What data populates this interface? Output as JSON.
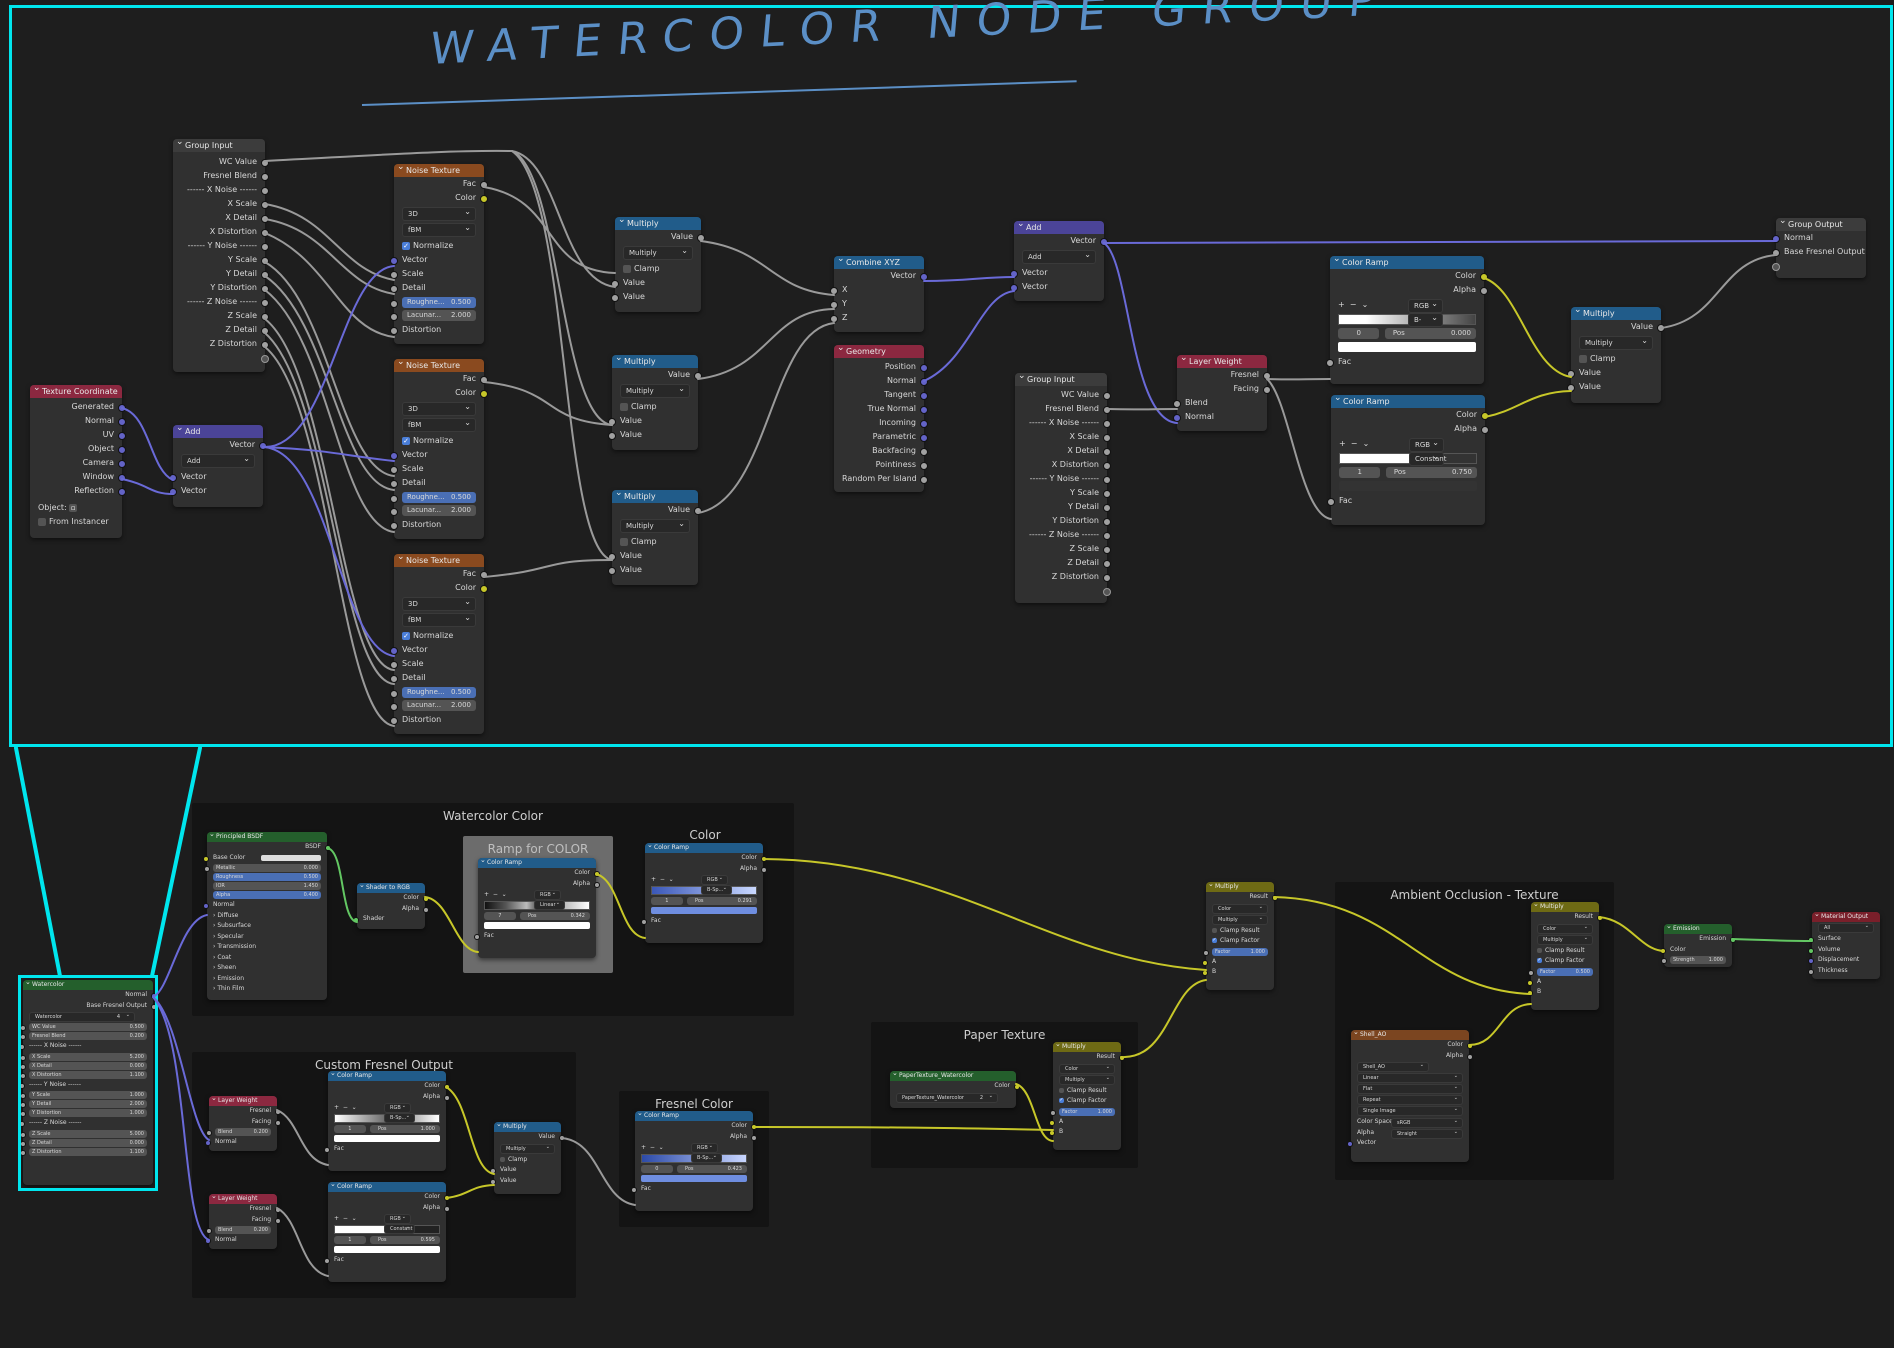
{
  "heading": "WATERCOLOR NODE GROUP",
  "colors": {
    "frame_highlight": "#00e6ee",
    "heading": "#5b8fc6",
    "socket_color": "#c7c729",
    "socket_vector": "#6363c7",
    "socket_float": "#a1a1a1",
    "socket_shader": "#63c763"
  },
  "group_input": {
    "title": "Group Input",
    "outputs": [
      "WC Value",
      "Fresnel Blend",
      "------ X Noise ------",
      "X Scale",
      "X Detail",
      "X Distortion",
      "------ Y Noise ------",
      "Y Scale",
      "Y Detail",
      "Y Distortion",
      "------ Z Noise ------",
      "Z Scale",
      "Z Detail",
      "Z Distortion"
    ]
  },
  "texcoord": {
    "title": "Texture Coordinate",
    "outputs": [
      "Generated",
      "Normal",
      "UV",
      "Object",
      "Camera",
      "Window",
      "Reflection"
    ],
    "object_label": "Object:",
    "from_instancer": "From Instancer"
  },
  "add_vec": {
    "title": "Add",
    "out": "Vector",
    "mode": "Add",
    "in1": "Vector",
    "in2": "Vector"
  },
  "noise": {
    "title": "Noise Texture",
    "fac": "Fac",
    "color": "Color",
    "dim": "3D",
    "type": "fBM",
    "normalize": "Normalize",
    "vector": "Vector",
    "scale": "Scale",
    "detail": "Detail",
    "rough_label": "Roughne...",
    "rough_val": "0.500",
    "lac_label": "Lacunar...",
    "lac_val": "2.000",
    "distortion": "Distortion"
  },
  "multiply": {
    "title": "Multiply",
    "out": "Value",
    "mode": "Multiply",
    "clamp": "Clamp",
    "in1": "Value",
    "in2": "Value"
  },
  "combine": {
    "title": "Combine XYZ",
    "out": "Vector",
    "x": "X",
    "y": "Y",
    "z": "Z"
  },
  "geometry": {
    "title": "Geometry",
    "outputs": [
      "Position",
      "Normal",
      "Tangent",
      "True Normal",
      "Incoming",
      "Parametric",
      "Backfacing",
      "Pointiness",
      "Random Per Island"
    ]
  },
  "add2": {
    "title": "Add",
    "out": "Vector",
    "mode": "Add",
    "in1": "Vector",
    "in2": "Vector"
  },
  "group_input2": {
    "title": "Group Input",
    "outputs": [
      "WC Value",
      "Fresnel Blend",
      "------ X Noise ------",
      "X Scale",
      "X Detail",
      "X Distortion",
      "------ Y Noise ------",
      "Y Scale",
      "Y Detail",
      "Y Distortion",
      "------ Z Noise ------",
      "Z Scale",
      "Z Detail",
      "Z Distortion"
    ]
  },
  "layer_weight": {
    "title": "Layer Weight",
    "fresnel": "Fresnel",
    "facing": "Facing",
    "blend": "Blend",
    "normal": "Normal"
  },
  "ramp1": {
    "title": "Color Ramp",
    "color": "Color",
    "alpha": "Alpha",
    "mode": "RGB",
    "interp": "B-Spline",
    "idx": "0",
    "pos_label": "Pos",
    "pos": "0.000",
    "fac": "Fac"
  },
  "ramp2": {
    "title": "Color Ramp",
    "color": "Color",
    "alpha": "Alpha",
    "mode": "RGB",
    "interp": "Constant",
    "idx": "1",
    "pos_label": "Pos",
    "pos": "0.750",
    "fac": "Fac"
  },
  "mult_top": {
    "title": "Multiply",
    "out": "Value",
    "mode": "Multiply",
    "clamp": "Clamp",
    "in1": "Value",
    "in2": "Value"
  },
  "group_output": {
    "title": "Group Output",
    "inputs": [
      "Normal",
      "Base Fresnel Output"
    ]
  },
  "wc_group": {
    "title": "Watercolor",
    "out1": "Normal",
    "out2": "Base Fresnel Output",
    "name": "Watercolor",
    "users": "4",
    "rows": [
      {
        "l": "WC Value",
        "v": "0.500"
      },
      {
        "l": "Fresnel Blend",
        "v": "0.200"
      },
      {
        "l": "------ X Noise ------",
        "v": ""
      },
      {
        "l": "X Scale",
        "v": "5.200"
      },
      {
        "l": "X Detail",
        "v": "0.000"
      },
      {
        "l": "X Distortion",
        "v": "1.100"
      },
      {
        "l": "------ Y Noise ------",
        "v": ""
      },
      {
        "l": "Y Scale",
        "v": "1.000"
      },
      {
        "l": "Y Detail",
        "v": "2.000"
      },
      {
        "l": "Y Distortion",
        "v": "1.000"
      },
      {
        "l": "------ Z Noise ------",
        "v": ""
      },
      {
        "l": "Z Scale",
        "v": "5.000"
      },
      {
        "l": "Z Detail",
        "v": "0.000"
      },
      {
        "l": "Z Distortion",
        "v": "1.100"
      }
    ]
  },
  "frames": {
    "watercolor_color": "Watercolor Color",
    "ramp_for_color": "Ramp for COLOR",
    "color": "Color",
    "custom_fresnel": "Custom Fresnel Output",
    "fresnel_color": "Fresnel Color",
    "paper_texture": "Paper Texture",
    "ao_texture": "Ambient Occlusion - Texture"
  },
  "bsdf": {
    "title": "Principled BSDF",
    "out": "BSDF",
    "base_color": "Base Color",
    "metallic": "Metallic",
    "metallic_v": "0.000",
    "roughness": "Roughness",
    "roughness_v": "0.500",
    "ior": "IOR",
    "ior_v": "1.450",
    "alpha": "Alpha",
    "alpha_v": "0.400",
    "normal": "Normal",
    "panels": [
      "Diffuse",
      "Subsurface",
      "Specular",
      "Transmission",
      "Coat",
      "Sheen",
      "Emission",
      "Thin Film"
    ]
  },
  "s2rgb": {
    "title": "Shader to RGB",
    "color": "Color",
    "alpha": "Alpha",
    "shader": "Shader"
  },
  "ramp_color_a": {
    "title": "Color Ramp",
    "color": "Color",
    "alpha": "Alpha",
    "mode": "RGB",
    "interp": "Linear",
    "idx": "7",
    "pos_label": "Pos",
    "pos": "0.342",
    "fac": "Fac"
  },
  "ramp_color_b": {
    "title": "Color Ramp",
    "color": "Color",
    "alpha": "Alpha",
    "mode": "RGB",
    "interp": "B-Sp...",
    "idx": "1",
    "pos_label": "Pos",
    "pos": "0.291",
    "fac": "Fac"
  },
  "lw_a": {
    "title": "Layer Weight",
    "fresnel": "Fresnel",
    "facing": "Facing",
    "blend": "Blend",
    "blend_v": "0.200",
    "normal": "Normal"
  },
  "lw_b": {
    "title": "Layer Weight",
    "fresnel": "Fresnel",
    "facing": "Facing",
    "blend": "Blend",
    "blend_v": "0.200",
    "normal": "Normal"
  },
  "ramp_cf_a": {
    "title": "Color Ramp",
    "color": "Color",
    "alpha": "Alpha",
    "mode": "RGB",
    "interp": "B-Sp...",
    "idx": "1",
    "pos_label": "Pos",
    "pos": "1.000",
    "fac": "Fac"
  },
  "ramp_cf_b": {
    "title": "Color Ramp",
    "color": "Color",
    "alpha": "Alpha",
    "mode": "RGB",
    "interp": "Constant",
    "idx": "1",
    "pos_label": "Pos",
    "pos": "0.595",
    "fac": "Fac"
  },
  "mult_cf": {
    "title": "Multiply",
    "out": "Value",
    "mode": "Multiply",
    "clamp": "Clamp",
    "in1": "Value",
    "in2": "Value"
  },
  "ramp_fc": {
    "title": "Color Ramp",
    "color": "Color",
    "alpha": "Alpha",
    "mode": "RGB",
    "interp": "B-Sp...",
    "idx": "0",
    "pos_label": "Pos",
    "pos": "0.423",
    "fac": "Fac"
  },
  "paper_group": {
    "title": "PaperTexture_Watercolor",
    "color": "Color",
    "name": "PaperTexture_Watercolor",
    "users": "2"
  },
  "mix_paper": {
    "title": "Multiply",
    "result": "Result",
    "type": "Color",
    "mode": "Multiply",
    "clamp_result": "Clamp Result",
    "clamp_factor": "Clamp Factor",
    "factor": "Factor",
    "factor_v": "1.000",
    "a": "A",
    "b": "B"
  },
  "mix_main": {
    "title": "Multiply",
    "result": "Result",
    "type": "Color",
    "mode": "Multiply",
    "clamp_result": "Clamp Result",
    "clamp_factor": "Clamp Factor",
    "factor": "Factor",
    "factor_v": "1.000",
    "a": "A",
    "b": "B"
  },
  "mix_ao": {
    "title": "Multiply",
    "result": "Result",
    "type": "Color",
    "mode": "Multiply",
    "clamp_result": "Clamp Result",
    "clamp_factor": "Clamp Factor",
    "factor": "Factor",
    "factor_v": "0.500",
    "a": "A",
    "b": "B"
  },
  "ao_img": {
    "title": "Shell_AO",
    "color": "Color",
    "alpha": "Alpha",
    "name": "Shell_AO",
    "interp": "Linear",
    "proj": "Flat",
    "ext": "Repeat",
    "source": "Single Image",
    "cs_label": "Color Space",
    "cs": "sRGB",
    "alpha_label": "Alpha",
    "alpha_mode": "Straight",
    "vector": "Vector"
  },
  "emission": {
    "title": "Emission",
    "out": "Emission",
    "color": "Color",
    "strength": "Strength",
    "strength_v": "1.000"
  },
  "mat_out": {
    "title": "Material Output",
    "target": "All",
    "surface": "Surface",
    "volume": "Volume",
    "displacement": "Displacement",
    "thickness": "Thickness"
  }
}
